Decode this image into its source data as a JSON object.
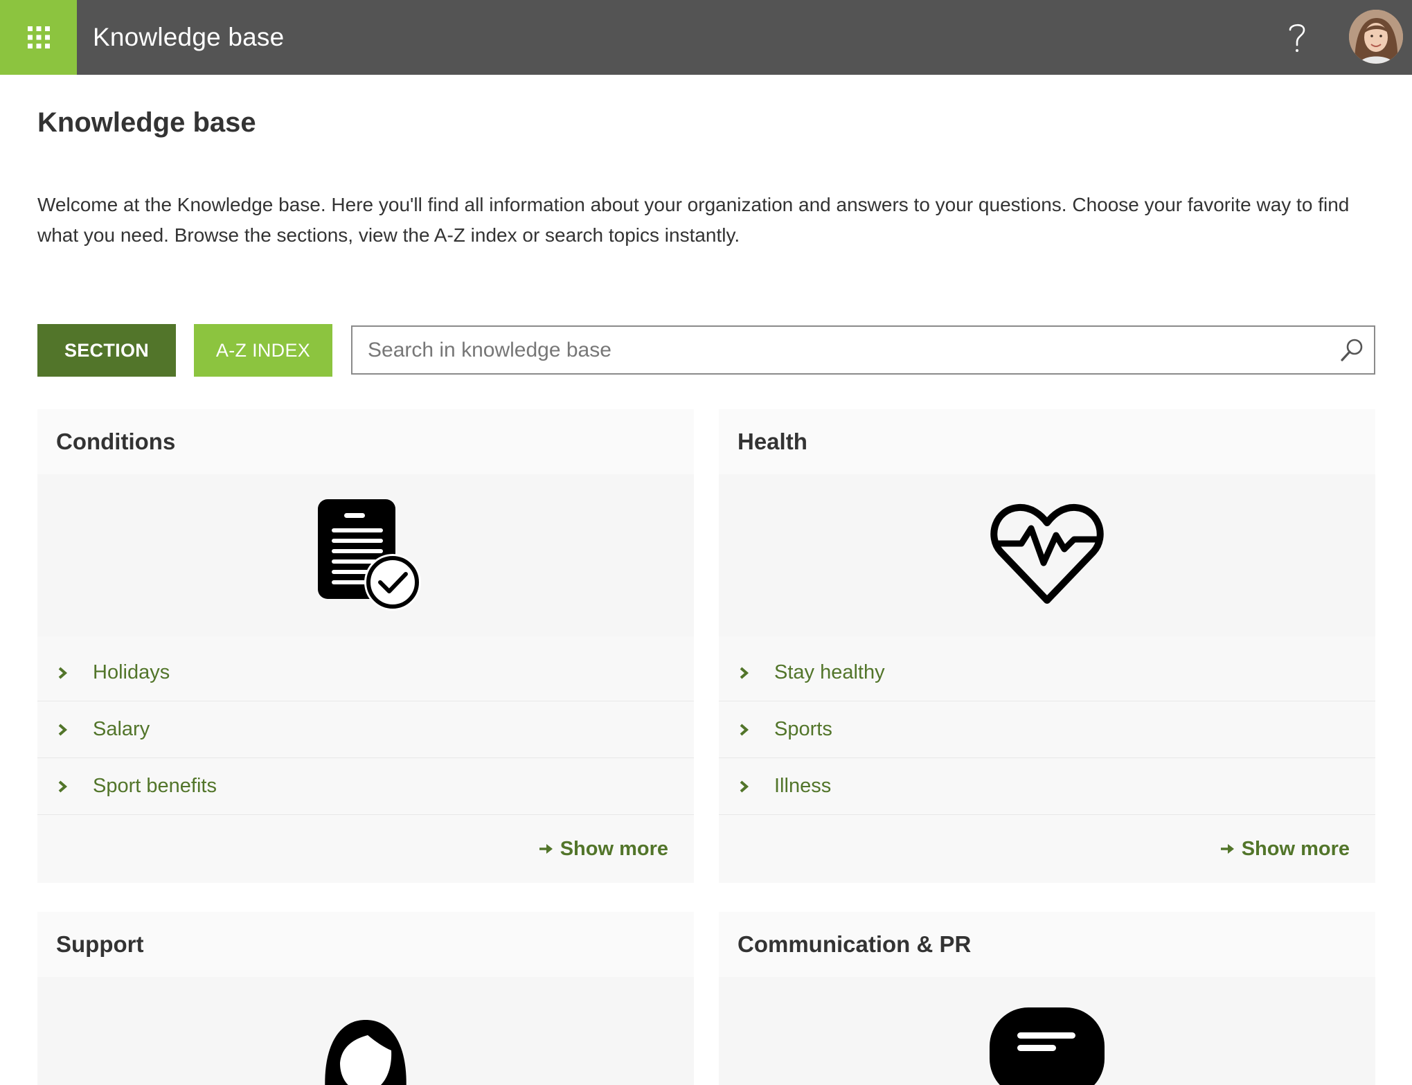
{
  "header": {
    "app_title": "Knowledge base",
    "help_label": "?"
  },
  "page": {
    "title": "Knowledge base",
    "intro": "Welcome at the Knowledge base. Here you'll find all information about your organization and answers to your questions. Choose your favorite way to find what you need. Browse the sections, view the A-Z index or search topics instantly."
  },
  "toolbar": {
    "section_label": "SECTION",
    "az_label": "A-Z INDEX",
    "search_placeholder": "Search in knowledge base"
  },
  "sections": [
    {
      "title": "Conditions",
      "icon": "document-check-icon",
      "links": [
        "Holidays",
        "Salary",
        "Sport benefits"
      ],
      "show_more": "Show more"
    },
    {
      "title": "Health",
      "icon": "heart-pulse-icon",
      "links": [
        "Stay healthy",
        "Sports",
        "Illness"
      ],
      "show_more": "Show more"
    },
    {
      "title": "Support",
      "icon": "support-agent-icon"
    },
    {
      "title": "Communication & PR",
      "icon": "chat-bubble-icon"
    }
  ],
  "colors": {
    "topbar": "#545454",
    "accent_light": "#8cc43f",
    "accent_dark": "#52752a"
  }
}
